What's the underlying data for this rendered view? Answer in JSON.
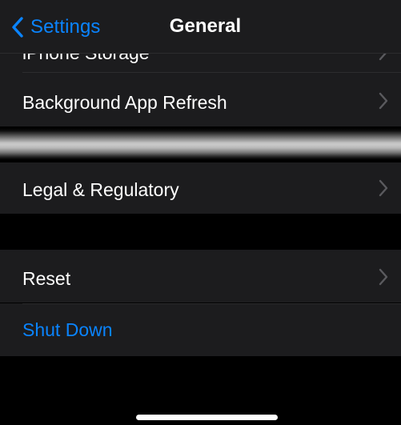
{
  "nav": {
    "back_label": "Settings",
    "title": "General"
  },
  "rows": {
    "storage": {
      "label": "iPhone Storage"
    },
    "background_refresh": {
      "label": "Background App Refresh"
    },
    "legal": {
      "label": "Legal & Regulatory"
    },
    "reset": {
      "label": "Reset"
    },
    "shut_down": {
      "label": "Shut Down"
    }
  },
  "colors": {
    "accent": "#0a84ff",
    "background": "#000000",
    "cell": "#1c1c1e",
    "chevron": "#5a5a5e"
  },
  "icons": {
    "back": "chevron-left-icon",
    "disclosure": "chevron-right-icon"
  }
}
